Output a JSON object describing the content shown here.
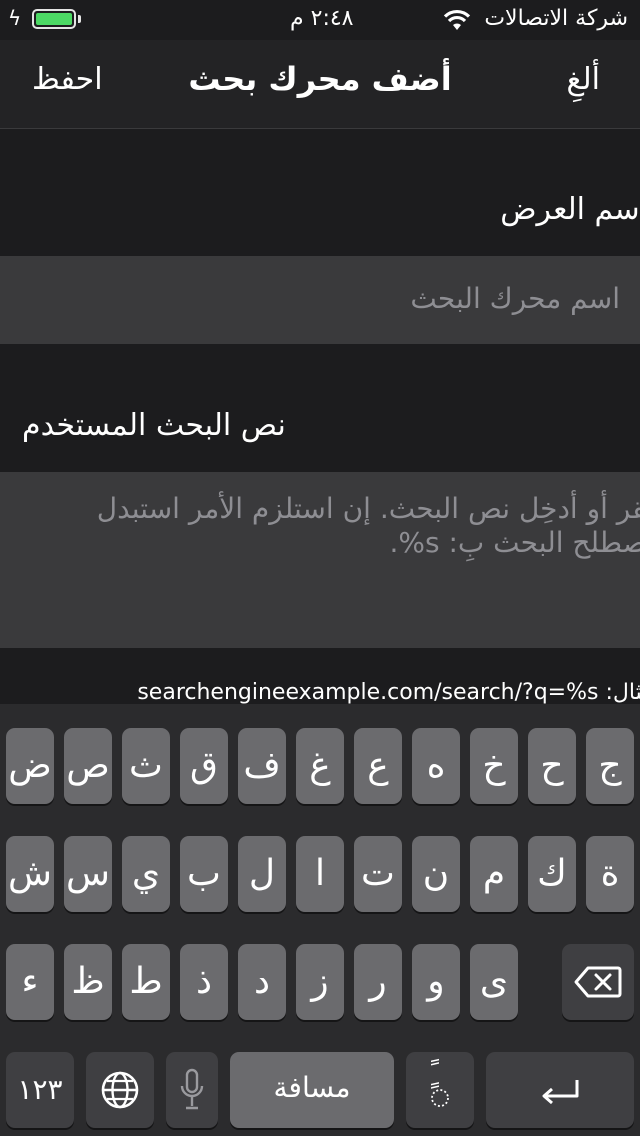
{
  "status_bar": {
    "carrier": "شركة الاتصالات",
    "time": "٢:٤٨ م",
    "battery_level": 1.0
  },
  "nav": {
    "cancel_label": "ألغِ",
    "title": "أضف محرك بحث",
    "save_label": "احفظ"
  },
  "form": {
    "display_name_label": "اسم العرض",
    "display_name_placeholder": "اسم محرك البحث",
    "search_text_label": "نص البحث المستخدم",
    "search_text_placeholder_line1": "انقر أو أدخِل نص البحث. إن استلزم الأمر استبدل",
    "search_text_placeholder_line2": "مصطلح البحث بِ: s%.",
    "example_text": "مثال: searchengineexample.com/search/?q=%s"
  },
  "keyboard": {
    "row1": [
      "ض",
      "ص",
      "ث",
      "ق",
      "ف",
      "غ",
      "ع",
      "ه",
      "خ",
      "ح",
      "ج"
    ],
    "row2": [
      "ش",
      "س",
      "ي",
      "ب",
      "ل",
      "ا",
      "ت",
      "ن",
      "م",
      "ك",
      "ة"
    ],
    "row3": [
      "ء",
      "ظ",
      "ط",
      "ذ",
      "د",
      "ز",
      "ر",
      "و",
      "ى"
    ],
    "numbers_label": "١٢٣",
    "space_label": "مسافة",
    "diacritic_label": "ًٍ",
    "icons": [
      "globe-icon",
      "microphone-icon",
      "backspace-icon",
      "return-icon",
      "charging-bolt-icon",
      "wifi-icon"
    ]
  }
}
